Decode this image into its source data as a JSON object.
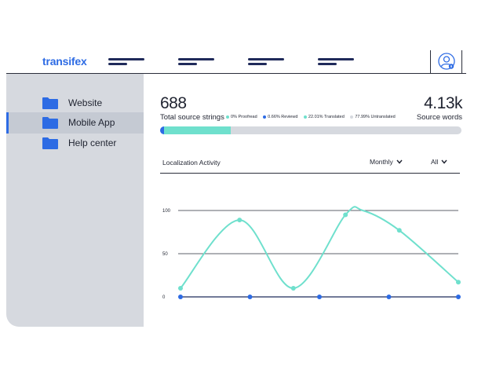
{
  "header": {
    "logo": "transifex",
    "nav_items": [
      "nav-1",
      "nav-2",
      "nav-3",
      "nav-4"
    ]
  },
  "sidebar": {
    "items": [
      {
        "label": "Website",
        "active": false
      },
      {
        "label": "Mobile App",
        "active": true
      },
      {
        "label": "Help center",
        "active": false
      }
    ]
  },
  "stats": {
    "total_strings": "688",
    "total_strings_label": "Total source strings",
    "source_words": "4.13k",
    "source_words_label": "Source words"
  },
  "legend": {
    "proofread": "0% Proofread",
    "reviewed": "0.66% Reviewd",
    "translated": "22.01% Translated",
    "untranslated": "77.99% Untranslated"
  },
  "progress": {
    "proofread_pct": 0,
    "reviewed_pct": 0.66,
    "translated_pct": 22.01,
    "untranslated_pct": 77.99
  },
  "colors": {
    "accent": "#2d6be4",
    "teal": "#6fe0cd",
    "track": "#d6d9df",
    "proofread": "#6fe0cd",
    "reviewed": "#2d6be4",
    "translated": "#6fe0cd",
    "untranslated": "#d6d9df"
  },
  "activity": {
    "title": "Localization Activity",
    "period": "Monthly",
    "filter": "All"
  },
  "chart_data": {
    "type": "line",
    "x": [
      0,
      1,
      2,
      3,
      4,
      5,
      6,
      7,
      8
    ],
    "series": [
      {
        "values": [
          10,
          null,
          89,
          null,
          10,
          null,
          95,
          null,
          17
        ],
        "smooth": true
      }
    ],
    "highlight_points": [
      {
        "x": 0,
        "y": 10
      },
      {
        "x": 1.7,
        "y": 89
      },
      {
        "x": 3.25,
        "y": 10
      },
      {
        "x": 4.75,
        "y": 95
      },
      {
        "x": 6.3,
        "y": 77
      },
      {
        "x": 8,
        "y": 17
      }
    ],
    "peak_curve": [
      {
        "x": 0,
        "y": 10
      },
      {
        "x": 1.7,
        "y": 89
      },
      {
        "x": 3.25,
        "y": 10
      },
      {
        "x": 4.75,
        "y": 95
      },
      {
        "x": 5.25,
        "y": 100
      },
      {
        "x": 6.3,
        "y": 77
      },
      {
        "x": 8,
        "y": 17
      }
    ],
    "baseline_points": [
      0,
      2,
      4,
      6,
      8
    ],
    "yticks": [
      0,
      50,
      100
    ],
    "ylim": [
      0,
      100
    ],
    "grid": true
  }
}
